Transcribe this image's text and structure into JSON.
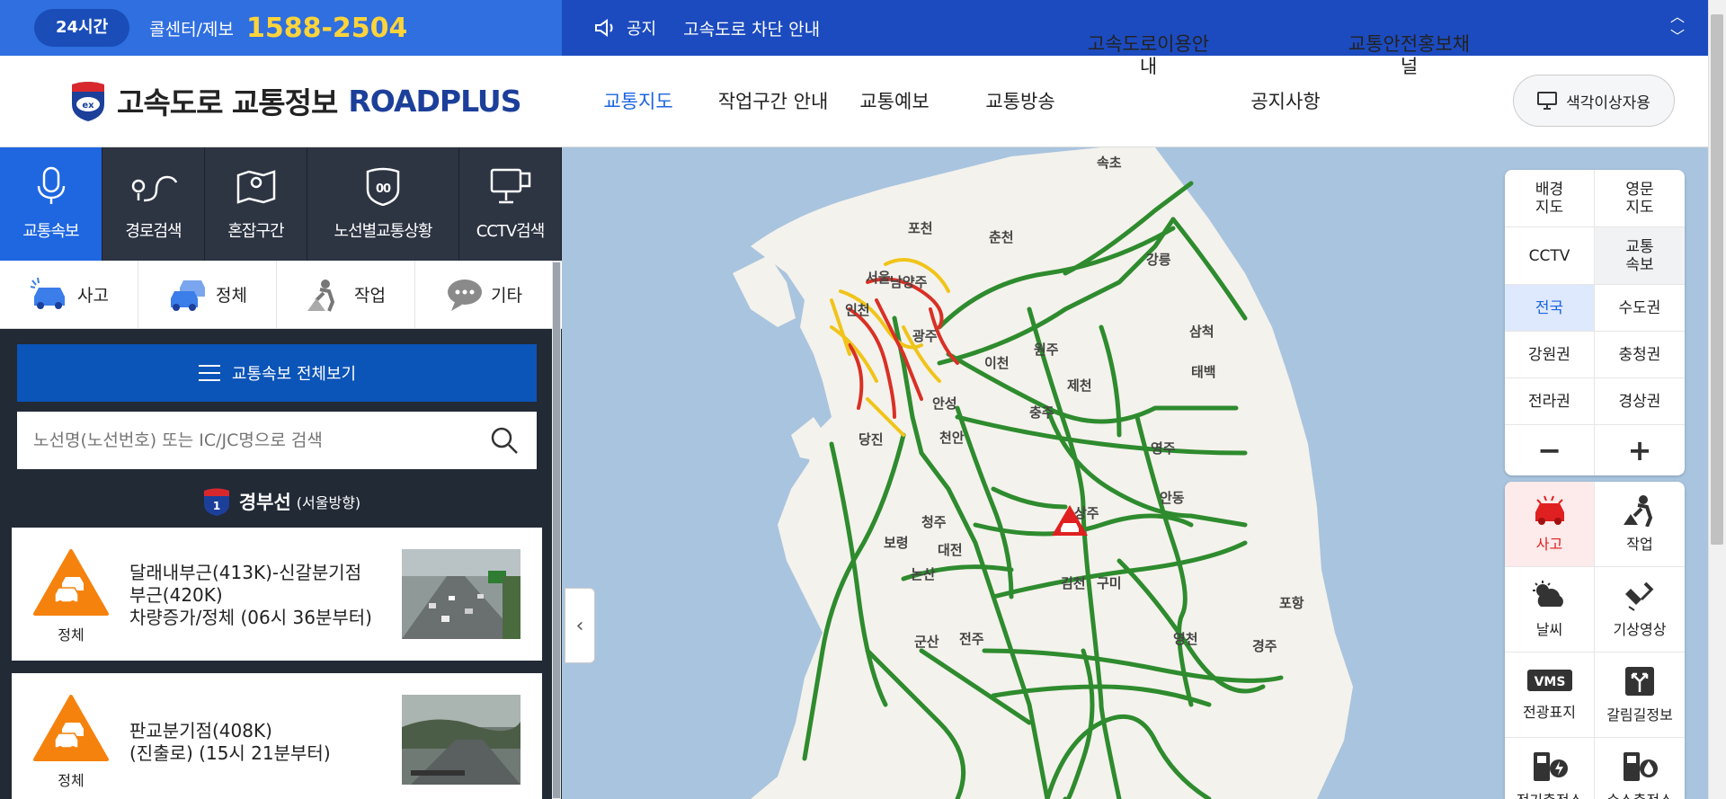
{
  "topbar": {
    "hours_badge": "24시간",
    "callcenter_label": "콜센터/제보",
    "callcenter_number": "1588-2504",
    "notice_label": "공지",
    "notice_text": "고속도로 차단 안내"
  },
  "header": {
    "logo_text": "고속도로 교통정보",
    "logo_en": "ROADPLUS",
    "nav": [
      {
        "label": "교통지도",
        "active": true
      },
      {
        "label": "작업구간 안내"
      },
      {
        "label": "교통예보"
      },
      {
        "label": "교통방송"
      },
      {
        "label": "고속도로이용안\n내"
      },
      {
        "label": "공지사항"
      },
      {
        "label": "교통안전홍보채\n널"
      }
    ],
    "colorblind_button": "색각이상자용"
  },
  "left_panel": {
    "tabs": [
      {
        "label": "교통속보",
        "icon": "microphone-icon",
        "active": true
      },
      {
        "label": "경로검색",
        "icon": "route-icon"
      },
      {
        "label": "혼잡구간",
        "icon": "map-pin-icon"
      },
      {
        "label": "노선별교통상황",
        "icon": "highway-shield-icon"
      },
      {
        "label": "CCTV검색",
        "icon": "cctv-icon"
      }
    ],
    "categories": [
      {
        "label": "사고",
        "icon": "accident-car-icon"
      },
      {
        "label": "정체",
        "icon": "congestion-cars-icon"
      },
      {
        "label": "작업",
        "icon": "roadwork-icon"
      },
      {
        "label": "기타",
        "icon": "speech-bubble-icon"
      }
    ],
    "view_all_button": "교통속보 전체보기",
    "search_placeholder": "노선명(노선번호) 또는 IC/JC명으로 검색",
    "route": {
      "number": "1",
      "name": "경부선",
      "direction": "(서울방향)"
    },
    "incidents": [
      {
        "type": "정체",
        "line1": "달래내부근(413K)-신갈분기점",
        "line2": "부근(420K)",
        "line3": "차량증가/정체 (06시 36분부터)"
      },
      {
        "type": "정체",
        "line1": "판교분기점(408K)",
        "line2": "(진출로) (15시 21분부터)",
        "line3": ""
      }
    ]
  },
  "map": {
    "labels": [
      "속초",
      "포천",
      "춘천",
      "강릉",
      "서울",
      "남양주",
      "인천",
      "광주",
      "삼척",
      "이천",
      "원주",
      "태백",
      "제천",
      "안성",
      "충주",
      "당진",
      "천안",
      "영주",
      "안동",
      "청주",
      "상주",
      "보령",
      "대전",
      "김천",
      "구미",
      "논산",
      "포항",
      "군산",
      "전주",
      "영천",
      "경주"
    ],
    "controls": [
      {
        "label": "배경\n지도"
      },
      {
        "label": "영문\n지도"
      },
      {
        "label": "CCTV"
      },
      {
        "label": "교통\n속보"
      },
      {
        "label": "전국",
        "selected": true
      },
      {
        "label": "수도권"
      },
      {
        "label": "강원권"
      },
      {
        "label": "충청권"
      },
      {
        "label": "전라권"
      },
      {
        "label": "경상권"
      }
    ],
    "zoom_out": "−",
    "zoom_in": "+",
    "layers": [
      {
        "label": "사고",
        "icon": "accident-icon",
        "selected": true
      },
      {
        "label": "작업",
        "icon": "worker-icon"
      },
      {
        "label": "날씨",
        "icon": "weather-icon"
      },
      {
        "label": "기상영상",
        "icon": "satellite-icon"
      },
      {
        "label": "전광표지",
        "icon": "vms-sign-icon",
        "badge": "VMS"
      },
      {
        "label": "갈림길정보",
        "icon": "junction-icon"
      },
      {
        "label": "전기충전소",
        "icon": "ev-charger-icon"
      },
      {
        "label": "수소충전소",
        "icon": "hydrogen-charger-icon"
      }
    ]
  },
  "colors": {
    "topbar_left": "#2f6fe0",
    "topbar_right": "#1c4bbf",
    "accent_blue": "#1e67e0",
    "road_green": "#2e8b2e",
    "road_red": "#d93025",
    "road_yellow": "#f0c419",
    "incident_orange": "#f5820d"
  }
}
